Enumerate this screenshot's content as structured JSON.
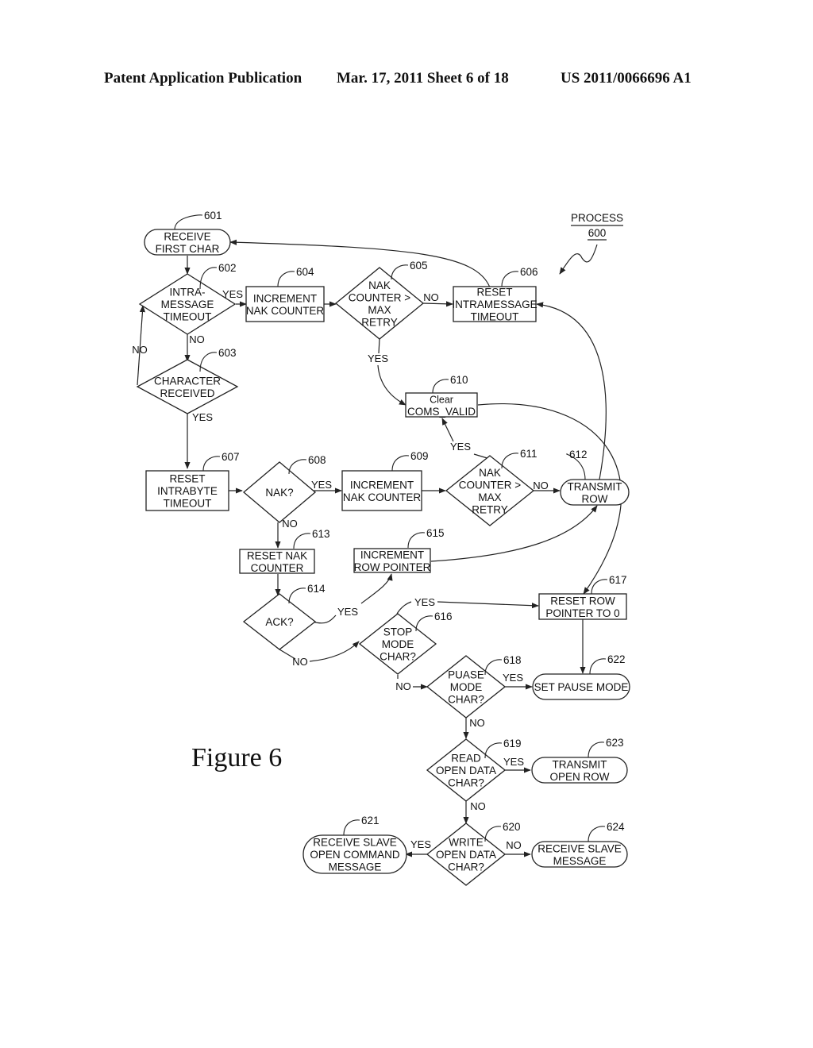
{
  "header": {
    "left": "Patent Application Publication",
    "middle": "Mar. 17, 2011  Sheet 6 of 18",
    "right": "US 2011/0066696 A1"
  },
  "figure_label": "Figure 6",
  "process": {
    "title": "PROCESS",
    "number": "600"
  },
  "nodes": {
    "n601": {
      "ref": "601",
      "shape": "terminal",
      "lines": [
        "RECEIVE",
        "FIRST CHAR"
      ]
    },
    "n602": {
      "ref": "602",
      "shape": "decision",
      "lines": [
        "INTRA-",
        "MESSAGE",
        "TIMEOUT"
      ]
    },
    "n603": {
      "ref": "603",
      "shape": "decision",
      "lines": [
        "CHARACTER",
        "RECEIVED"
      ]
    },
    "n604": {
      "ref": "604",
      "shape": "process",
      "lines": [
        "INCREMENT",
        "NAK COUNTER"
      ]
    },
    "n605": {
      "ref": "605",
      "shape": "decision",
      "lines": [
        "NAK",
        "COUNTER >",
        "MAX",
        "RETRY"
      ]
    },
    "n606": {
      "ref": "606",
      "shape": "process",
      "lines": [
        "RESET",
        "INTRAMESSAGE",
        "TIMEOUT"
      ]
    },
    "n607": {
      "ref": "607",
      "shape": "process",
      "lines": [
        "RESET",
        "INTRABYTE",
        "TIMEOUT"
      ]
    },
    "n608": {
      "ref": "608",
      "shape": "decision",
      "lines": [
        "NAK?"
      ]
    },
    "n609": {
      "ref": "609",
      "shape": "process",
      "lines": [
        "INCREMENT",
        "NAK COUNTER"
      ]
    },
    "n610": {
      "ref": "610",
      "shape": "process",
      "lines": [
        "Clear",
        "COMS_VALID"
      ]
    },
    "n611": {
      "ref": "611",
      "shape": "decision",
      "lines": [
        "NAK",
        "COUNTER >",
        "MAX",
        "RETRY"
      ]
    },
    "n612": {
      "ref": "612",
      "shape": "terminal",
      "lines": [
        "TRANSMIT",
        "ROW"
      ]
    },
    "n613": {
      "ref": "613",
      "shape": "process",
      "lines": [
        "RESET NAK",
        "COUNTER"
      ]
    },
    "n614": {
      "ref": "614",
      "shape": "decision",
      "lines": [
        "ACK?"
      ]
    },
    "n615": {
      "ref": "615",
      "shape": "process",
      "lines": [
        "INCREMENT",
        "ROW POINTER"
      ]
    },
    "n616": {
      "ref": "616",
      "shape": "decision",
      "lines": [
        "STOP",
        "MODE",
        "CHAR?"
      ]
    },
    "n617": {
      "ref": "617",
      "shape": "process",
      "lines": [
        "RESET ROW",
        "POINTER TO 0"
      ]
    },
    "n618": {
      "ref": "618",
      "shape": "decision",
      "lines": [
        "PUASE",
        "MODE",
        "CHAR?"
      ]
    },
    "n619": {
      "ref": "619",
      "shape": "decision",
      "lines": [
        "READ",
        "OPEN DATA",
        "CHAR?"
      ]
    },
    "n620": {
      "ref": "620",
      "shape": "decision",
      "lines": [
        "WRITE",
        "OPEN DATA",
        "CHAR?"
      ]
    },
    "n621": {
      "ref": "621",
      "shape": "terminal",
      "lines": [
        "RECEIVE SLAVE",
        "OPEN COMMAND",
        "MESSAGE"
      ]
    },
    "n622": {
      "ref": "622",
      "shape": "terminal",
      "lines": [
        "SET PAUSE MODE"
      ]
    },
    "n623": {
      "ref": "623",
      "shape": "terminal",
      "lines": [
        "TRANSMIT",
        "OPEN ROW"
      ]
    },
    "n624": {
      "ref": "624",
      "shape": "terminal",
      "lines": [
        "RECEIVE SLAVE",
        "MESSAGE"
      ]
    }
  },
  "edge_labels": {
    "e602_604": "YES",
    "e602_603": "NO",
    "e603_602": "NO",
    "e603_607": "YES",
    "e605_606": "NO",
    "e605_610": "YES",
    "e608_609": "YES",
    "e608_613": "NO",
    "e611_612": "NO",
    "e611_610": "YES",
    "e614_615": "YES",
    "e614_616": "NO",
    "e616_617": "YES",
    "e616_618": "NO",
    "e618_622": "YES",
    "e618_619": "NO",
    "e619_623": "YES",
    "e619_620": "NO",
    "e620_621": "YES",
    "e620_624": "NO"
  }
}
